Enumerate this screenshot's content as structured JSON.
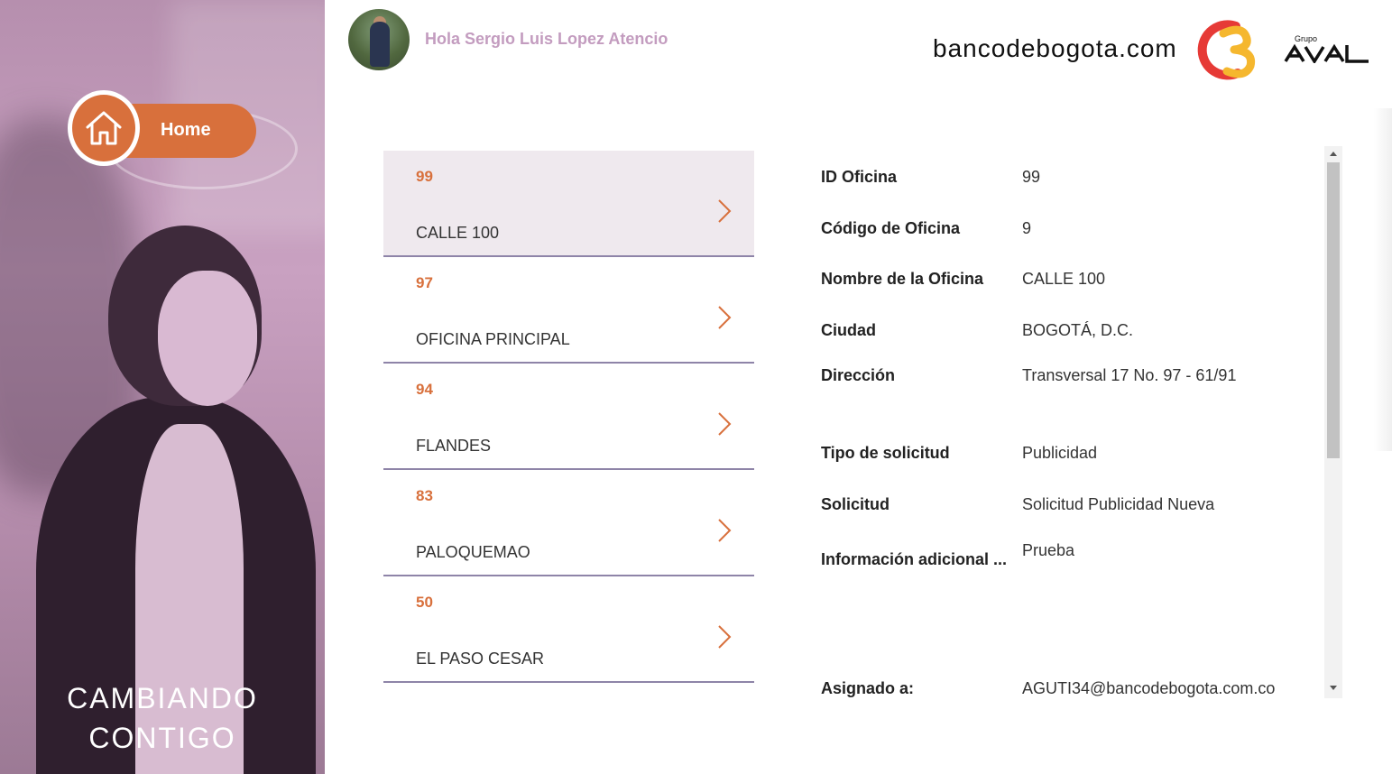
{
  "header": {
    "greeting": "Hola Sergio Luis Lopez Atencio",
    "brand_domain": "bancodebogota.com",
    "group_small": "Grupo",
    "group_name": "AVAL"
  },
  "nav": {
    "home_label": "Home"
  },
  "hero": {
    "line1": "CAMBIANDO",
    "line2": "CONTIGO"
  },
  "offices": [
    {
      "id": "99",
      "name": "CALLE 100",
      "selected": true
    },
    {
      "id": "97",
      "name": "OFICINA PRINCIPAL",
      "selected": false
    },
    {
      "id": "94",
      "name": "FLANDES",
      "selected": false
    },
    {
      "id": "83",
      "name": "PALOQUEMAO",
      "selected": false
    },
    {
      "id": "50",
      "name": "EL PASO CESAR",
      "selected": false
    }
  ],
  "details": {
    "id_oficina": {
      "label": "ID Oficina",
      "value": "99"
    },
    "codigo": {
      "label": "Código de Oficina",
      "value": "9"
    },
    "nombre": {
      "label": "Nombre de la Oficina",
      "value": "CALLE 100"
    },
    "ciudad": {
      "label": "Ciudad",
      "value": "BOGOTÁ, D.C."
    },
    "direccion": {
      "label": "Dirección",
      "value": "Transversal 17 No. 97 - 61/91"
    },
    "tipo": {
      "label": "Tipo de solicitud",
      "value": "Publicidad"
    },
    "solicitud": {
      "label": "Solicitud",
      "value": "Solicitud Publicidad Nueva"
    },
    "info": {
      "label": "Información adicional ...",
      "value": "Prueba"
    },
    "asignado": {
      "label": "Asignado a:",
      "value": "AGUTI34@bancodebogota.com.co"
    }
  },
  "colors": {
    "accent": "#d8703c",
    "greeting": "#c39cbf",
    "divider": "#8e84a8",
    "selected_bg": "#efe9ee",
    "hero_tint": "#c9a1c1"
  }
}
